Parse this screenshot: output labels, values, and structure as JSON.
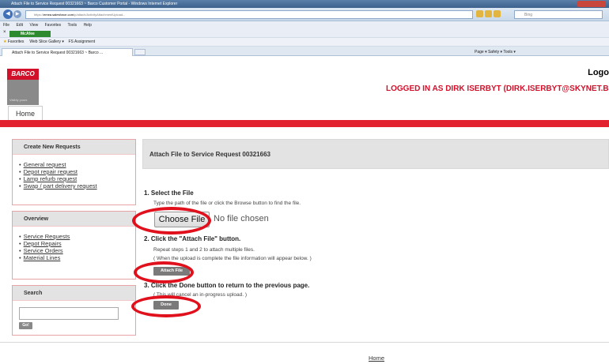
{
  "browser": {
    "window_title": "Attach File to Service Request 00321663 ~ Barco Customer Portal - Windows Internet Explorer",
    "url_prefix": "https://",
    "url_domain": "emea.salesforce.com",
    "url_rest": "/p/attach/ActivityAttachmentUpload...",
    "search_placeholder": "Bing",
    "menu": [
      "File",
      "Edit",
      "View",
      "Favorites",
      "Tools",
      "Help"
    ],
    "mcafee_label": "McAfee",
    "favorites_label": "Favorites",
    "fav_items": [
      "Web Slice Gallery ▾",
      "FS Assignment"
    ],
    "tab_title": "Attach File to Service Request 00321663 ~ Barco ...",
    "command_bar": "Page ▾   Safety ▾   Tools ▾"
  },
  "header": {
    "logo_text": "BARCO",
    "logo_sub": "Visibly yours",
    "logout_label": "Logo",
    "logged_in_text": "LOGGED IN AS DIRK ISERBYT (DIRK.ISERBYT@SKYNET.B",
    "home_tab": "Home"
  },
  "sidebar": {
    "new_requests": {
      "title": "Create New Requests",
      "items": [
        "General request",
        "Depot repair request",
        "Lamp refurb request",
        "Swap / part delivery request"
      ]
    },
    "overview": {
      "title": "Overview",
      "items": [
        "Service Requests",
        "Depot Repairs",
        "Service Orders",
        "Material Lines"
      ]
    },
    "search": {
      "title": "Search",
      "go_label": "Go!"
    }
  },
  "main": {
    "heading": "Attach File to Service Request 00321663",
    "step1_title": "1. Select the File",
    "step1_text": "Type the path of the file or click the Browse button to find the file.",
    "choose_file_label": "Choose File",
    "no_file_label": "No file chosen",
    "step2_title": "2. Click the \"Attach File\" button.",
    "step2_text1": "Repeat steps 1 and 2 to attach multiple files.",
    "step2_text2": "( When the upload is complete the file information will appear below. )",
    "attach_label": "Attach File",
    "step3_title": "3. Click the Done button to return to the previous page.",
    "step3_text": "( This will cancel an in-progress upload. )",
    "done_label": "Done"
  },
  "footer": {
    "home_link": "Home"
  },
  "colors": {
    "brand_red": "#e2232f",
    "annotation_red": "#e0101c",
    "panel_border": "#e8a3a6"
  }
}
